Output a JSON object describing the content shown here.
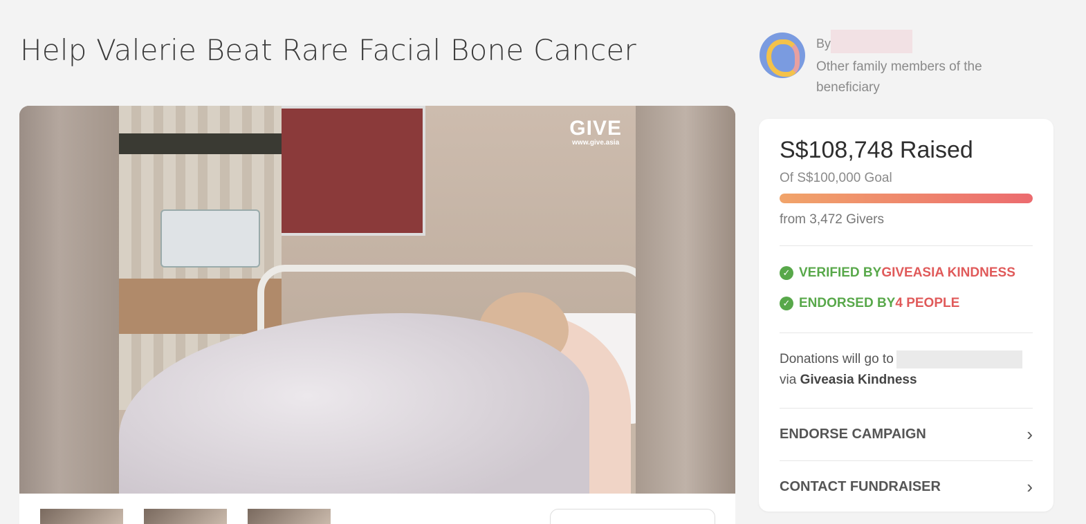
{
  "campaign": {
    "title": "Help Valerie Beat Rare Facial Bone Cancer"
  },
  "media": {
    "watermark_brand": "GIVE",
    "watermark_url": "www.give.asia",
    "thumbnail_count": 3
  },
  "author": {
    "by_label": "By",
    "relation": "Other family members of the beneficiary"
  },
  "funding": {
    "raised": "S$108,748 Raised",
    "goal": "Of S$100,000 Goal",
    "progress_fraction": 1.0,
    "givers": "from 3,472 Givers"
  },
  "badges": {
    "verified_prefix": "VERIFIED BY ",
    "verified_by": "GIVEASIA KINDNESS",
    "endorsed_prefix": "ENDORSED BY ",
    "endorsed_by": "4 PEOPLE"
  },
  "donations": {
    "prefix": "Donations will go to",
    "via_label": "via ",
    "via_name": "Giveasia Kindness"
  },
  "actions": {
    "endorse": "ENDORSE CAMPAIGN",
    "contact": "CONTACT FUNDRAISER"
  },
  "colors": {
    "accent_red": "#e05a5a",
    "verified_green": "#58a84a",
    "progress_start": "#f1a46a",
    "progress_end": "#ec6b6f"
  }
}
